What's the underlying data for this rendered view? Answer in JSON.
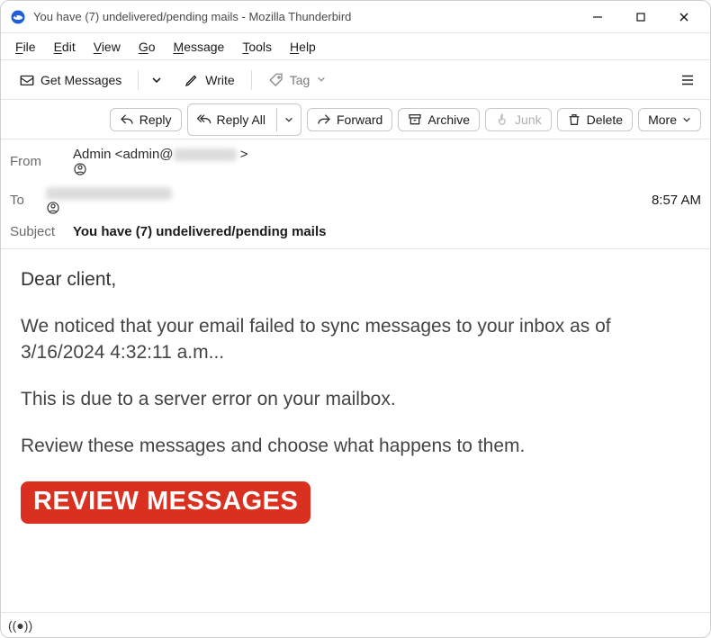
{
  "window": {
    "title": "You have (7) undelivered/pending mails - Mozilla Thunderbird"
  },
  "menu": {
    "file": "File",
    "edit": "Edit",
    "view": "View",
    "go": "Go",
    "message": "Message",
    "tools": "Tools",
    "help": "Help"
  },
  "toolbar": {
    "get_messages": "Get Messages",
    "write": "Write",
    "tag": "Tag"
  },
  "msgtoolbar": {
    "reply": "Reply",
    "reply_all": "Reply All",
    "forward": "Forward",
    "archive": "Archive",
    "junk": "Junk",
    "delete": "Delete",
    "more": "More"
  },
  "headers": {
    "from_label": "From",
    "from_value": "Admin <admin@",
    "from_close": " > ",
    "to_label": "To",
    "time": "8:57 AM",
    "subject_label": "Subject",
    "subject_value": "You have (7) undelivered/pending mails"
  },
  "body": {
    "greet": "Dear client,",
    "p1": "We noticed that your email failed to sync messages to your inbox as of 3/16/2024 4:32:11 a.m...",
    "p2": "This is due to a server error on your mailbox.",
    "p3": "Review these messages and choose what happens to them.",
    "cta": "REVIEW MESSAGES"
  },
  "status": {
    "sync_icon": "((●))"
  }
}
